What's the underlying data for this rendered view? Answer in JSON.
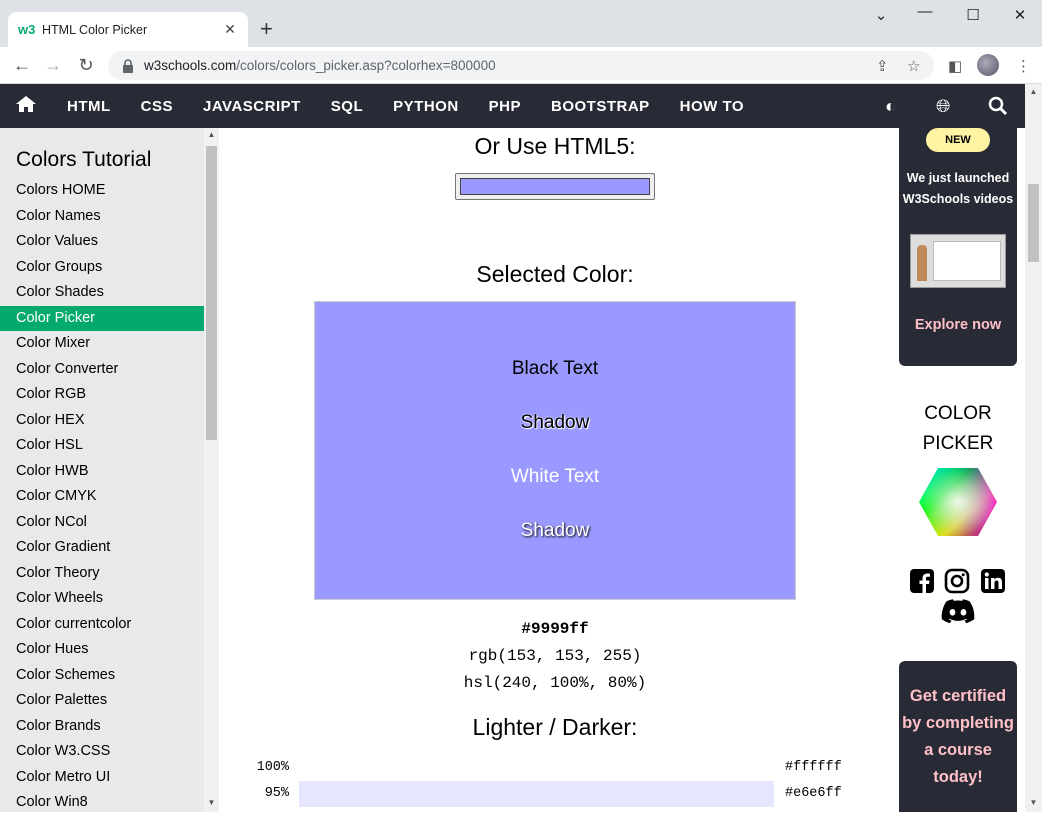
{
  "browser": {
    "tab_title": "HTML Color Picker",
    "favicon": "w3",
    "url_host": "w3schools.com",
    "url_path": "/colors/colors_picker.asp?colorhex=800000"
  },
  "topnav": {
    "items": [
      "HTML",
      "CSS",
      "JAVASCRIPT",
      "SQL",
      "PYTHON",
      "PHP",
      "BOOTSTRAP",
      "HOW TO"
    ]
  },
  "sidebar": {
    "title": "Colors Tutorial",
    "items": [
      "Colors HOME",
      "Color Names",
      "Color Values",
      "Color Groups",
      "Color Shades",
      "Color Picker",
      "Color Mixer",
      "Color Converter",
      "Color RGB",
      "Color HEX",
      "Color HSL",
      "Color HWB",
      "Color CMYK",
      "Color NCol",
      "Color Gradient",
      "Color Theory",
      "Color Wheels",
      "Color currentcolor",
      "Color Hues",
      "Color Schemes",
      "Color Palettes",
      "Color Brands",
      "Color W3.CSS",
      "Color Metro UI",
      "Color Win8"
    ],
    "active_index": 5
  },
  "main": {
    "html5_heading": "Or Use HTML5:",
    "selected_heading": "Selected Color:",
    "selected_color": "#9999ff",
    "demo": {
      "black_text": "Black Text",
      "black_shadow": "Shadow",
      "white_text": "White Text",
      "white_shadow": "Shadow"
    },
    "hex": "#9999ff",
    "rgb": "rgb(153, 153, 255)",
    "hsl": "hsl(240, 100%, 80%)",
    "lighter_darker_heading": "Lighter / Darker:",
    "shades": [
      {
        "pct": "100%",
        "hex": "#ffffff"
      },
      {
        "pct": "95%",
        "hex": "#e6e6ff"
      }
    ]
  },
  "right": {
    "new_badge": "NEW",
    "promo_line1": "We just launched",
    "promo_line2": "W3Schools videos",
    "promo_link": "Explore now",
    "color_picker_line1": "COLOR",
    "color_picker_line2": "PICKER",
    "cert_lines": [
      "Get certified",
      "by completing",
      "a course",
      "today!"
    ]
  },
  "colors": {
    "w3_green": "#04aa6d",
    "nav_dark": "#282a35",
    "sidebar_bg": "#e7e9eb",
    "promo_pink": "#ffc0c7",
    "badge_yellow": "#fff4a3"
  }
}
